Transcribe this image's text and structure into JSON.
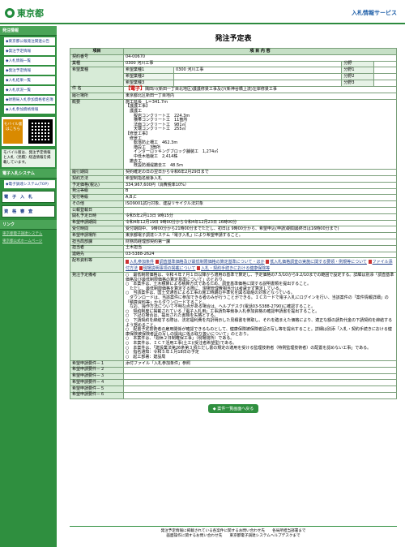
{
  "header": {
    "logo_text": "東京都",
    "site_title": "入札情報サービス"
  },
  "sidebar": {
    "section1": "発注情報",
    "items": [
      "◆東京都公報発注関連公告",
      "◆発注予定情報",
      "◆入札情報一覧",
      "◆発注予定情報",
      "◆入札結果一覧",
      "◆入札状況一覧",
      "◆財務局入札参加資格者名簿",
      "◆入札参加資格情報"
    ],
    "mobile_label": "モバイル版はこちら",
    "mobile_note": "モバイル版は、発注予定情報と入札（見積）経過情報を掲載しています。",
    "section2": "電子入札システム",
    "ebid_link": "◆電子調達システム(TOP)",
    "big_btn_1": "電 子 入 札",
    "big_btn_2": "資 格 審 査",
    "section3": "リンク",
    "links": [
      "東京都電子調達システム",
      "東京都公式ホームページ"
    ]
  },
  "main": {
    "page_title": "発注予定表",
    "col_item": "項目",
    "col_content": "項 目 内 容",
    "rows": {
      "contract_no_label": "契約番号",
      "contract_no": "04-00670",
      "business_label": "業種",
      "business": "0300 河川工事",
      "field_label": "分野",
      "field_value": "",
      "hope_label": "希望業種",
      "hope_1_label": "希望業種1",
      "hope_1": "0300 河川工事",
      "hope_2_label": "希望業種2",
      "hope_2": "",
      "hope_3_label": "希望業種3",
      "hope_3": "",
      "field_1_label": "分野1",
      "field_2_label": "分野2",
      "field_3_label": "分野3",
      "subject_label": "件 名",
      "subject_badge": "【電子】",
      "subject": "隅田川(新田一丁目北地区)護護修景工事及び(新神谷橋上流)左岸修景工事",
      "place_label": "履行場所",
      "place": "東京都北区新田一丁目地内",
      "summary_label": "概要",
      "summary": "施工延長　L＝341.7m\n【護護工事】\n　護護工\n　　擬岩コンクリート工　224.3m\n　　横帯コンクリート工　11箇所\n　　法面コンクリート工　981㎡\n　　天端コンクリート工　255㎡\n【修景工事】\n　修景工\n　　転落防止柵工　462.3m\n　　階段工　3箇所\n　　インターロッキングブロック舗装工　1,274㎡\n　　中低木植栽工　2,414株\n　撤去工\n　　既設防潮堤撤去工　48.5m",
      "period_label": "履行期間",
      "period": "契約確定の日の翌日から令和6年2月29日まで",
      "method_label": "契約方法",
      "method": "希望制指名競争入札",
      "price_label": "予定価格(税込)",
      "price": "334,967,600円（消費税率10%）",
      "grade_label": "発注等級",
      "grade": "B",
      "accept_label": "受付等級",
      "accept": "A,B,C",
      "other_label": "その他",
      "other": "ISO9001試行対象、建設リサイクル法対象",
      "announce_label": "公報登載日",
      "announce": "",
      "open_label": "開札予定日時",
      "open": "令和5年2月13日 9時15分",
      "apply_label": "希望申請期間",
      "apply": "令和4年12月19日 9時00分から令和4年12月23日 16時00分",
      "accept_period_label": "受付時間",
      "accept_period": "受付期間中、 9時00分から21時00分までただし、初日は 9時00分から、希望申込(申請)期間最終日は16時00分まで)",
      "apply_method_label": "希望申請場所",
      "apply_method": "東京都電子調達システム「電子入札」により希望申請すること。",
      "dept_label": "担当局部課",
      "dept": "財務局経理部契約第一課",
      "person_label": "担当者",
      "person": "土木担当",
      "tel_label": "連絡先",
      "tel": "03-5388-2624",
      "docs_label": "配布資料等",
      "docs": [
        "入札参加条件",
        "調査基準価格及び最低制限価格の算定基準について・ほか",
        "低入札価格調査の実施に関する要領・例規等について",
        "ファイル添付方法",
        "現場説明事項の掲載について",
        "入札・契約手続きにおける健康保険等"
      ],
      "notes_label": "発注予定備考",
      "notes": "○　最低制限価格は、令和４年７月１日以降から適用の基準で算定し、予定価格の7.5/10から9.2/10までの範囲で設定する。詳細は別添「調査基準価格及び最低制限価格の算定基準について」のとおり。\n○　本案件は、土木積算による積算方式であるため、調査基準価格に関する説明書類を提出すること。\n　ただし、最低制限価格を算定する際に、現場管理費相当分は考慮せず算定している。\n○　当該案件は、国土交通省による工事の施工時期の平準化を図る取組の対象となっている。\n　ダウンロードは、当該案件に参加できる者のみが行うことができる。ＩＣカードで電子入札にログインを行い、当該案件の「案件情報詳細」の「積算資料等」からダウンロードすること。\n　なお、操作方法について不明な点がある場合は、ヘルプデスク(電話03-5388-2790)に確認すること。\n○　契約制度に掲載されている「電子入札用」工事請負等競争入札参加資格の確認申請書を提出すること。\n○　下記の場合は、提出された書類を失格とする。\n○　下請契約を締結する際は、法定福利費を内訳明示した見積書を徴取し、それを踏まえた価格により、適正な額の請負代金の下請契約を締結するよう努めること。\n○　配置予定技術者の雇用関係が確認できるものとして、健康保険被保険者証の写し等を提出すること。詳細は別添「入札・契約手続きにおける健康保険被保険者証の写しの提出に係る取り扱いについて」のとおり。\n○　本案件は、「週休２日制確保工事」（現場閉所）である。\n○　本案件は、ＩＣＴ活用工事(土工)(受注者希望型)である。\n○　本案件は、「建設業法第26条第３項ただし書の規定の適用を受ける監理技術者（特例監理技術者）の配置を認めない工事」である。\n○　指名通知：令和５年１月18日の予定\n○　起工部署：建設局",
      "doc_fee_label": "希望申請要件－１",
      "doc_fee": "添付ファイル「入札参加条件」参照",
      "req2_label": "希望申請要件－２",
      "req3_label": "希望申請要件－３",
      "req4_label": "希望申請要件－４",
      "req5_label": "希望申請要件－５",
      "req6_label": "希望申請要件－６"
    },
    "back_button": "◆ 案件一覧画面へ戻る"
  },
  "footer": {
    "line1": "発注予定情報に掲載されている各案件に関するお問い合わせ先　　各局所担当部署まで",
    "line2": "画面操作に関するお問い合わせ先　　東京都電子調達システムヘルプデスクまで"
  }
}
